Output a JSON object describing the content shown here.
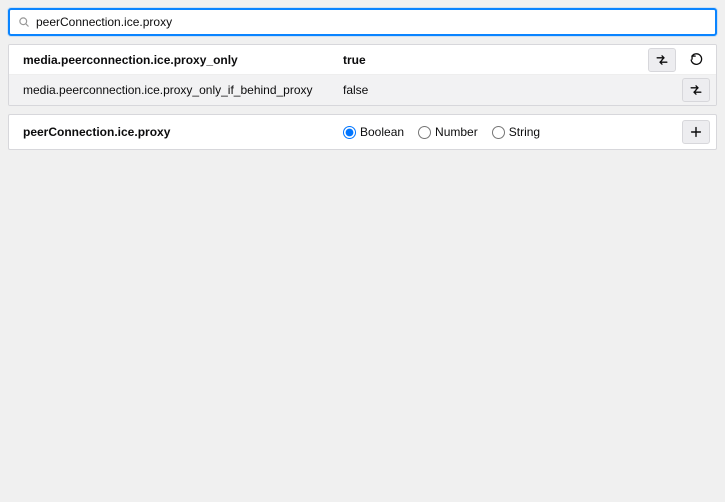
{
  "search": {
    "value": "peerConnection.ice.proxy",
    "placeholder": ""
  },
  "prefs": [
    {
      "name": "media.peerconnection.ice.proxy_only",
      "value": "true",
      "modified": true,
      "hasReset": true
    },
    {
      "name": "media.peerconnection.ice.proxy_only_if_behind_proxy",
      "value": "false",
      "modified": false,
      "hasReset": false
    }
  ],
  "newPref": {
    "name": "peerConnection.ice.proxy",
    "types": [
      "Boolean",
      "Number",
      "String"
    ],
    "selected": "Boolean"
  }
}
